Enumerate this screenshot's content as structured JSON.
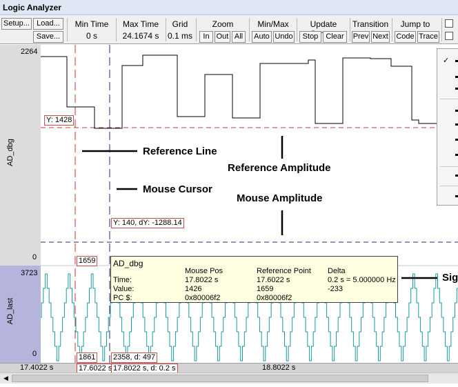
{
  "window": {
    "title": "Logic Analyzer"
  },
  "toolbar": {
    "setup": "Setup...",
    "load": "Load...",
    "save": "Save...",
    "min_time": {
      "title": "Min Time",
      "value": "0 s"
    },
    "max_time": {
      "title": "Max Time",
      "value": "24.1674 s"
    },
    "grid": {
      "title": "Grid",
      "value": "0.1 ms"
    },
    "zoom": {
      "title": "Zoom",
      "in": "In",
      "out": "Out",
      "all": "All"
    },
    "minmax": {
      "title": "Min/Max",
      "auto": "Auto",
      "undo": "Undo"
    },
    "update_screen": {
      "title": "Update Screen",
      "stop": "Stop",
      "clear": "Clear"
    },
    "transition": {
      "title": "Transition",
      "prev": "Prev",
      "next": "Next"
    },
    "jump_to": {
      "title": "Jump to",
      "code": "Code",
      "trace": "Trace"
    }
  },
  "signals": [
    {
      "name": "AD_dbg",
      "max": "2264",
      "min": "0"
    },
    {
      "name": "AD_last",
      "max": "3723",
      "min": "0"
    }
  ],
  "plot_labels": {
    "ref_y": "Y: 1428",
    "mouse_y": "Y: 140, dY: -1288.14",
    "ref_val": "1659",
    "mouse_val_lower": "2358,  d: 497",
    "ref_val_lower": "1861"
  },
  "annotations": {
    "reference_line": "Reference Line",
    "reference_amplitude": "Reference Amplitude",
    "mouse_cursor": "Mouse Cursor",
    "mouse_amplitude": "Mouse Amplitude",
    "sig": "Sig"
  },
  "tooltip": {
    "signal": "AD_dbg",
    "headers": [
      "Mouse Pos",
      "Reference Point",
      "Delta"
    ],
    "rows": [
      {
        "label": "Time:",
        "mouse": "17.8022 s",
        "ref": "17.6022 s",
        "delta": "0.2 s = 5.000000 Hz"
      },
      {
        "label": "Value:",
        "mouse": "1426",
        "ref": "1659",
        "delta": "-233"
      },
      {
        "label": "PC $:",
        "mouse": "0x80006f2",
        "ref": "0x80006f2",
        "delta": ""
      }
    ]
  },
  "time_axis": {
    "start": "17.4022 s",
    "ref": "17.6022 s",
    "mouse": "17.8022 s,  d: 0.2 s",
    "mid": "18.8022 s"
  },
  "colors": {
    "ref_line": "#c83030",
    "mouse_line": "#2a2a6a",
    "wave1": "#000000",
    "wave2": "#1a9aa0",
    "panel1": "#dcdcdc",
    "panel2": "#b4b4dc"
  }
}
